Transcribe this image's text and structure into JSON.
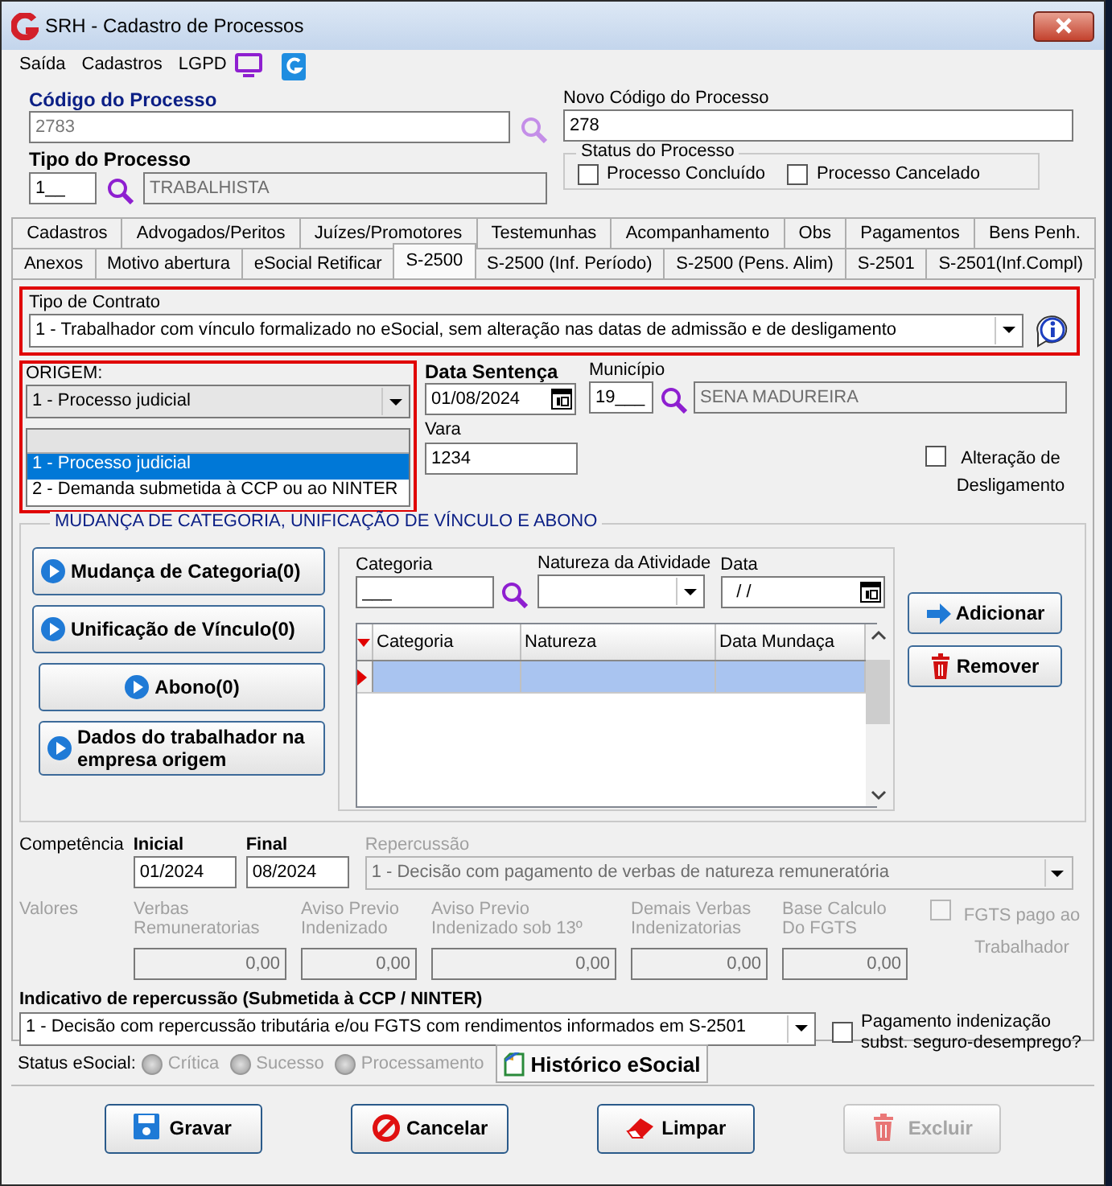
{
  "window": {
    "title": "SRH - Cadastro de Processos"
  },
  "menu": [
    {
      "label": "Saída"
    },
    {
      "label": "Cadastros"
    },
    {
      "label": "LGPD"
    }
  ],
  "header": {
    "codigo": {
      "label": "Código do Processo",
      "value": "2783"
    },
    "novo_codigo": {
      "label": "Novo Código do Processo",
      "value": "278"
    },
    "tipo": {
      "label": "Tipo do Processo",
      "code": "1__",
      "description": "TRABALHISTA"
    },
    "status": {
      "title": "Status do Processo",
      "options": [
        {
          "label": "Processo Concluído",
          "checked": false
        },
        {
          "label": "Processo Cancelado",
          "checked": false
        }
      ]
    }
  },
  "tab_rows": [
    {
      "tabs": [
        {
          "label": "Cadastros",
          "selected": false
        },
        {
          "label": "Advogados/Peritos",
          "selected": false
        },
        {
          "label": "Juízes/Promotores",
          "selected": false
        },
        {
          "label": "Testemunhas",
          "selected": false
        },
        {
          "label": "Acompanhamento",
          "selected": false
        },
        {
          "label": "Obs",
          "selected": false
        },
        {
          "label": "Pagamentos",
          "selected": false
        },
        {
          "label": "Bens Penh.",
          "selected": false
        }
      ]
    },
    {
      "tabs": [
        {
          "label": "Anexos",
          "selected": false
        },
        {
          "label": "Motivo abertura",
          "selected": false
        },
        {
          "label": "eSocial Retificar",
          "selected": false
        },
        {
          "label": "S-2500",
          "selected": true
        },
        {
          "label": "S-2500 (Inf. Período)",
          "selected": false
        },
        {
          "label": "S-2500 (Pens. Alim)",
          "selected": false
        },
        {
          "label": "S-2501",
          "selected": false
        },
        {
          "label": "S-2501(Inf.Compl)",
          "selected": false
        }
      ]
    }
  ],
  "tipo_contrato": {
    "label": "Tipo de Contrato",
    "value": "1 - Trabalhador com vínculo formalizado no eSocial, sem alteração nas datas de admissão e de desligamento",
    "highlighted": true
  },
  "origem": {
    "label": "ORIGEM:",
    "value": "1 - Processo judicial",
    "highlighted": true,
    "expanded": true,
    "options": [
      {
        "label": "1 - Processo judicial",
        "selected": true
      },
      {
        "label": "2 - Demanda submetida à CCP ou ao NINTER",
        "selected": false
      }
    ]
  },
  "data_sentenca": {
    "label": "Data Sentença",
    "value": "01/08/2024"
  },
  "municipio": {
    "label": "Município",
    "code": "19___",
    "name": "SENA MADUREIRA"
  },
  "vara": {
    "label": "Vara",
    "value": "1234"
  },
  "alteracao_desligamento": {
    "label": "Alteração de Desligamento",
    "checked": false
  },
  "group": {
    "title": "MUDANÇA DE CATEGORIA, UNIFICAÇÃO DE VÍNCULO E ABONO",
    "side_buttons": [
      {
        "label": "Mudança de Categoria(0)"
      },
      {
        "label": "Unificação de Vínculo(0)"
      },
      {
        "label": "Abono(0)"
      },
      {
        "label": "Dados do trabalhador na empresa origem"
      }
    ],
    "categoria": {
      "label": "Categoria",
      "value": "___"
    },
    "natureza": {
      "label": "Natureza da Atividade"
    },
    "data": {
      "label": "Data",
      "value": "/ /"
    },
    "actions": [
      {
        "label": "Adicionar",
        "kind": "add"
      },
      {
        "label": "Remover",
        "kind": "remove"
      }
    ],
    "grid": {
      "columns": [
        "Categoria",
        "Natureza",
        "Data Mundaça"
      ],
      "rows": [
        {
          "selected": true
        }
      ]
    }
  },
  "competencia": {
    "label": "Competência",
    "inicial": {
      "label": "Inicial",
      "value": "01/2024"
    },
    "final": {
      "label": "Final",
      "value": "08/2024"
    },
    "repercussao": {
      "label": "Repercussão",
      "value": "1 - Decisão com pagamento de verbas de natureza remuneratória",
      "disabled": true
    }
  },
  "valores": {
    "label": "Valores",
    "disabled": true,
    "fields": [
      {
        "label": "Verbas Remuneratorias",
        "value": "0,00"
      },
      {
        "label": "Aviso Previo Indenizado",
        "value": "0,00"
      },
      {
        "label": "Aviso Previo Indenizado sob 13º",
        "value": "0,00"
      },
      {
        "label": "Demais Verbas Indenizatorias",
        "value": "0,00"
      },
      {
        "label": "Base Calculo Do FGTS",
        "value": "0,00"
      }
    ],
    "fgts": {
      "label": "FGTS pago ao Trabalhador",
      "checked": false,
      "disabled": true
    }
  },
  "indicativo": {
    "label": "Indicativo de repercussão (Submetida à CCP / NINTER)",
    "value": "1 - Decisão com repercussão tributária e/ou FGTS com rendimentos informados em S-2501",
    "pagamento": {
      "label": "Pagamento indenização subst. seguro-desemprego?",
      "checked": false
    }
  },
  "status_esocial": {
    "label": "Status eSocial:",
    "options": [
      {
        "label": "Crítica",
        "disabled": true
      },
      {
        "label": "Sucesso",
        "disabled": true
      },
      {
        "label": "Processamento",
        "disabled": true
      }
    ],
    "historico": "Histórico eSocial"
  },
  "buttons": [
    {
      "label": "Gravar",
      "kind": "save",
      "disabled": false
    },
    {
      "label": "Cancelar",
      "kind": "cancel",
      "disabled": false
    },
    {
      "label": "Limpar",
      "kind": "clear",
      "disabled": false
    },
    {
      "label": "Excluir",
      "kind": "delete",
      "disabled": true
    }
  ]
}
